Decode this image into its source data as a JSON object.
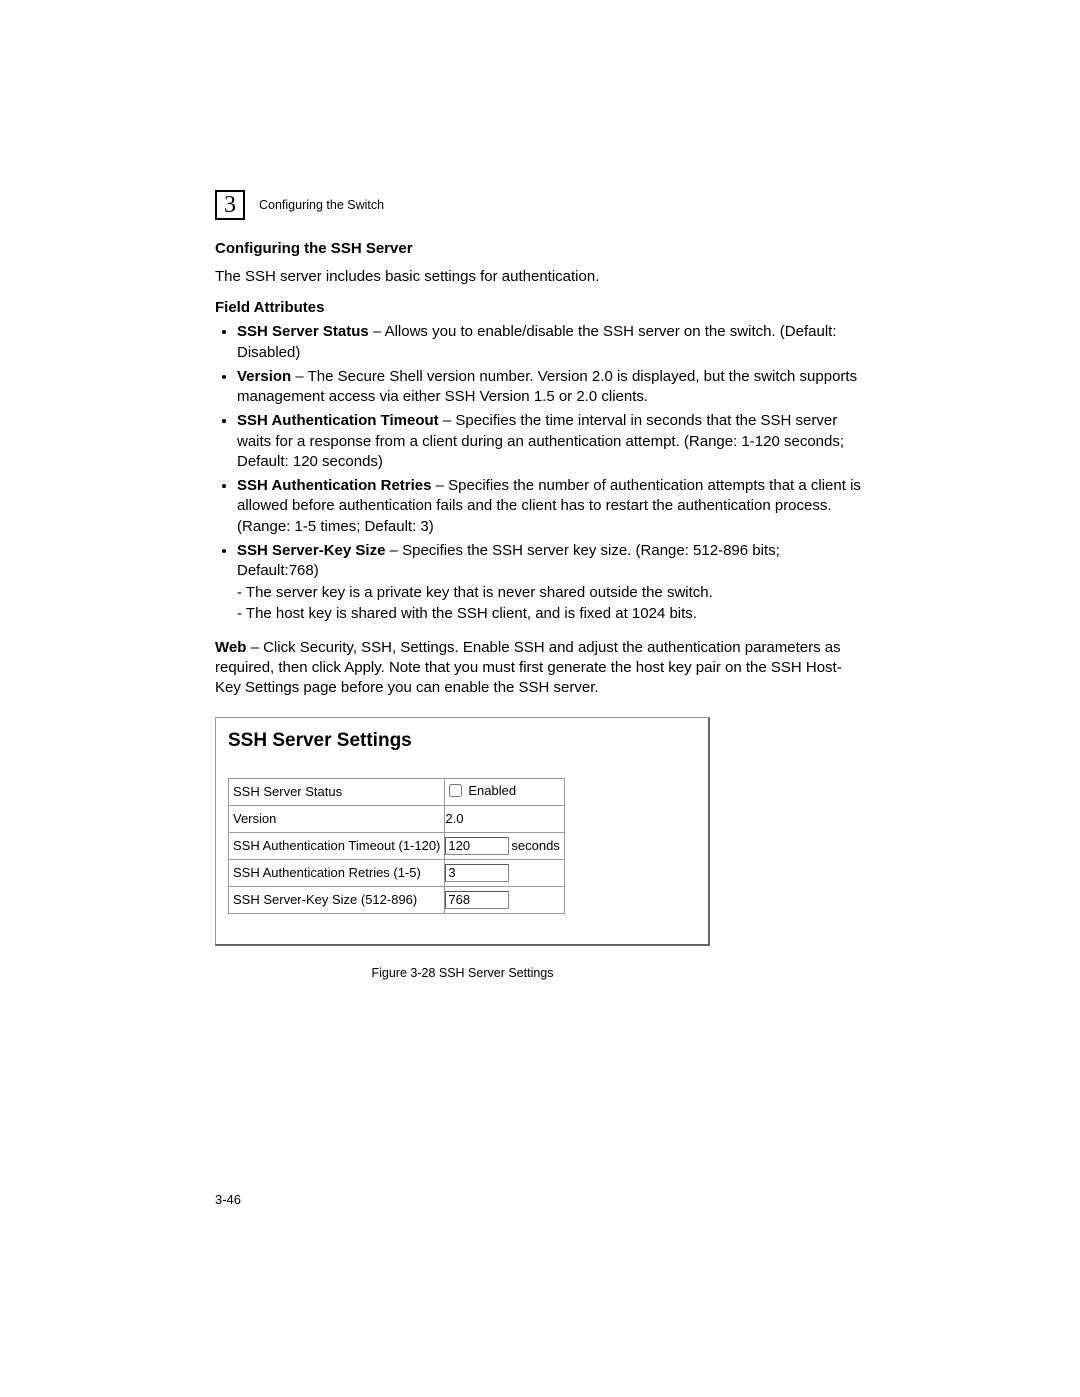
{
  "chapter": {
    "number": "3",
    "title": "Configuring the Switch"
  },
  "section": {
    "title": "Configuring the SSH Server",
    "intro": "The SSH server includes basic settings for authentication.",
    "field_attributes_label": "Field Attributes"
  },
  "attrs": {
    "i0": {
      "bold": "SSH Server Status",
      "rest": " – Allows you to enable/disable the SSH server on the switch. (Default: Disabled)"
    },
    "i1": {
      "bold": "Version",
      "rest": " – The Secure Shell version number. Version 2.0 is displayed, but the switch supports management access via either SSH Version 1.5 or 2.0 clients."
    },
    "i2": {
      "bold": "SSH Authentication Timeout",
      "rest": " – Specifies the time interval in seconds that the SSH server waits for a response from a client during an authentication attempt. (Range: 1-120 seconds; Default: 120 seconds)"
    },
    "i3": {
      "bold": "SSH Authentication Retries",
      "rest": " – Specifies the number of authentication attempts that a client is allowed before authentication fails and the client has to restart the authentication process. (Range: 1-5 times; Default: 3)"
    },
    "i4": {
      "bold": "SSH Server-Key Size",
      "rest": " – Specifies the SSH server key size. (Range: 512-896 bits; Default:768)"
    },
    "i4_sub1": "The server key is a private key that is never shared outside the switch.",
    "i4_sub2": "The host key is shared with the SSH client, and is fixed at 1024 bits."
  },
  "web": {
    "bold": "Web",
    "rest": " – Click Security, SSH, Settings. Enable SSH and adjust the authentication parameters as required, then click Apply. Note that you must first generate the host key pair on the SSH Host-Key Settings page before you can enable the SSH server."
  },
  "panel": {
    "title": "SSH Server Settings",
    "rows": {
      "status_label": "SSH Server Status",
      "status_checkbox_label": "Enabled",
      "status_checked": false,
      "version_label": "Version",
      "version_value": "2.0",
      "timeout_label": "SSH Authentication Timeout (1-120)",
      "timeout_value": "120",
      "timeout_unit": "seconds",
      "retries_label": "SSH Authentication Retries (1-5)",
      "retries_value": "3",
      "keysize_label": "SSH Server-Key Size (512-896)",
      "keysize_value": "768"
    }
  },
  "figure_caption": "Figure 3-28  SSH Server Settings",
  "page_num": "3-46"
}
